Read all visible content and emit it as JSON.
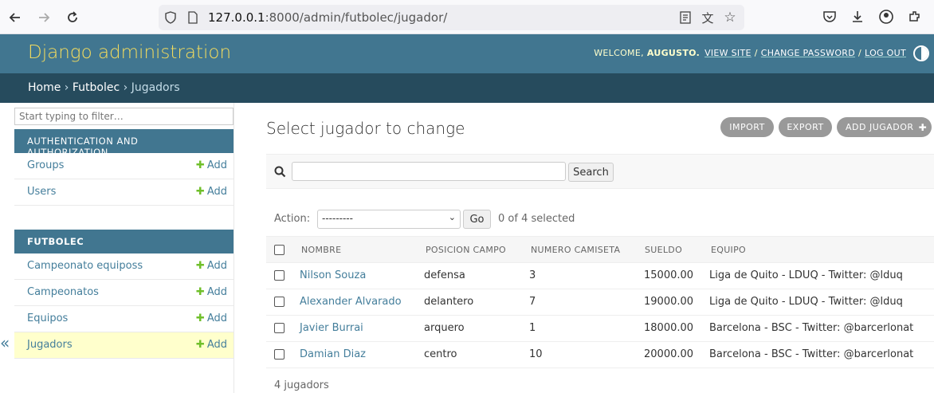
{
  "browser": {
    "url_prefix": "127.0.0.1",
    "url_rest": ":8000/admin/futbolec/jugador/"
  },
  "header": {
    "branding": "Django administration",
    "welcome": "WELCOME,",
    "username": "AUGUSTO.",
    "view_site": "VIEW SITE",
    "change_password": "CHANGE PASSWORD",
    "log_out": "LOG OUT",
    "sep": "/"
  },
  "breadcrumbs": {
    "home": "Home",
    "app": "Futbolec",
    "current": "Jugadors",
    "sep": "›"
  },
  "sidebar": {
    "filter_placeholder": "Start typing to filter…",
    "add_label": "Add",
    "apps": [
      {
        "caption": "AUTHENTICATION AND AUTHORIZATION",
        "models": [
          "Groups",
          "Users"
        ]
      },
      {
        "caption": "FUTBOLEC",
        "models": [
          "Campeonato equiposs",
          "Campeonatos",
          "Equipos",
          "Jugadors"
        ]
      }
    ],
    "collapse": "«"
  },
  "main": {
    "title": "Select jugador to change",
    "import_label": "IMPORT",
    "export_label": "EXPORT",
    "add_label": "ADD JUGADOR",
    "search_button": "Search",
    "action_label": "Action:",
    "action_selected": "---------",
    "go_label": "Go",
    "selected_count": "0 of 4 selected",
    "columns": [
      "NOMBRE",
      "POSICION CAMPO",
      "NUMERO CAMISETA",
      "SUELDO",
      "EQUIPO"
    ],
    "rows": [
      [
        "Nilson Souza",
        "defensa",
        "3",
        "15000.00",
        "Liga de Quito - LDUQ - Twitter: @lduq"
      ],
      [
        "Alexander Alvarado",
        "delantero",
        "7",
        "19000.00",
        "Liga de Quito - LDUQ - Twitter: @lduq"
      ],
      [
        "Javier Burrai",
        "arquero",
        "1",
        "18000.00",
        "Barcelona - BSC - Twitter: @barcerlonat"
      ],
      [
        "Damian Diaz",
        "centro",
        "10",
        "20000.00",
        "Barcelona - BSC - Twitter: @barcerlonat"
      ]
    ],
    "paginator": "4 jugadors"
  },
  "colors": {
    "header": "#417690",
    "breadcrumbs": "#264b5d",
    "branding": "#f5dd5d",
    "link": "#447e9b",
    "add_green": "#70bf2b",
    "current_row": "#ffffcc"
  }
}
